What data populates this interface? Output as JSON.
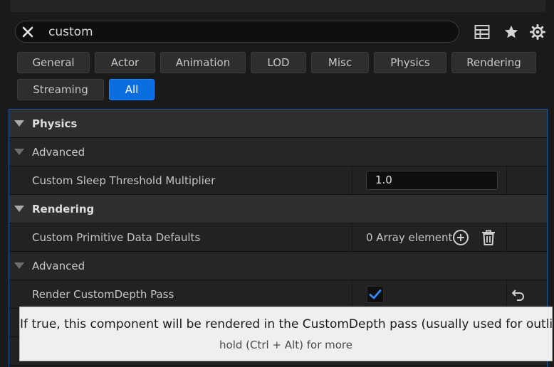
{
  "search": {
    "value": "custom"
  },
  "filters": [
    "General",
    "Actor",
    "Animation",
    "LOD",
    "Misc",
    "Physics",
    "Rendering",
    "Streaming",
    "All"
  ],
  "active_filter": "All",
  "sections": {
    "physics": "Physics",
    "physics_advanced": "Advanced",
    "sleep_label": "Custom Sleep Threshold Multiplier",
    "sleep_value": "1.0",
    "rendering": "Rendering",
    "cpd_label": "Custom Primitive Data Defaults",
    "cpd_value": "0 Array element",
    "rendering_advanced": "Advanced",
    "depth_label": "Render CustomDepth Pass"
  },
  "tooltip": {
    "text": "If true, this component will be rendered in the CustomDepth pass (usually used for outlines)",
    "hint": "hold (Ctrl + Alt) for more"
  },
  "colors": {
    "accent": "#0a6de0",
    "panel_border": "#1f5c9e",
    "tooltip_bg": "#efefef"
  }
}
